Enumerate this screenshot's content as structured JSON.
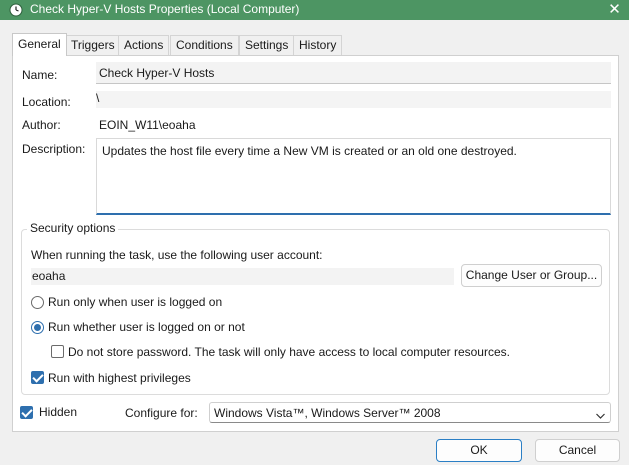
{
  "window": {
    "title": "Check Hyper-V Hosts Properties (Local Computer)",
    "close_glyph": "✕",
    "title_bg": "#4d9563"
  },
  "tabs": [
    {
      "label": "General",
      "active": true
    },
    {
      "label": "Triggers",
      "active": false
    },
    {
      "label": "Actions",
      "active": false
    },
    {
      "label": "Conditions",
      "active": false
    },
    {
      "label": "Settings",
      "active": false
    },
    {
      "label": "History",
      "active": false
    }
  ],
  "general": {
    "name_label": "Name:",
    "name_value": "Check Hyper-V Hosts",
    "location_label": "Location:",
    "location_value": "\\",
    "author_label": "Author:",
    "author_value": "EOIN_W11\\eoaha",
    "description_label": "Description:",
    "description_value": "Updates the host file every time a New VM is created or an old one destroyed."
  },
  "security": {
    "title": "Security options",
    "account_prompt": "When running the task, use the following user account:",
    "account_value": "eoaha",
    "change_button": "Change User or Group...",
    "radio_logged_on": "Run only when user is logged on",
    "radio_whether": "Run whether user is logged on or not",
    "selected_radio": "whether",
    "no_store_password": "Do not store password.  The task will only have access to local computer resources.",
    "no_store_checked": false,
    "highest_privileges": "Run with highest privileges",
    "highest_checked": true
  },
  "footer": {
    "hidden_label": "Hidden",
    "hidden_checked": true,
    "configure_label": "Configure for:",
    "configure_value": "Windows Vista™, Windows Server™ 2008"
  },
  "buttons": {
    "ok": "OK",
    "cancel": "Cancel"
  }
}
